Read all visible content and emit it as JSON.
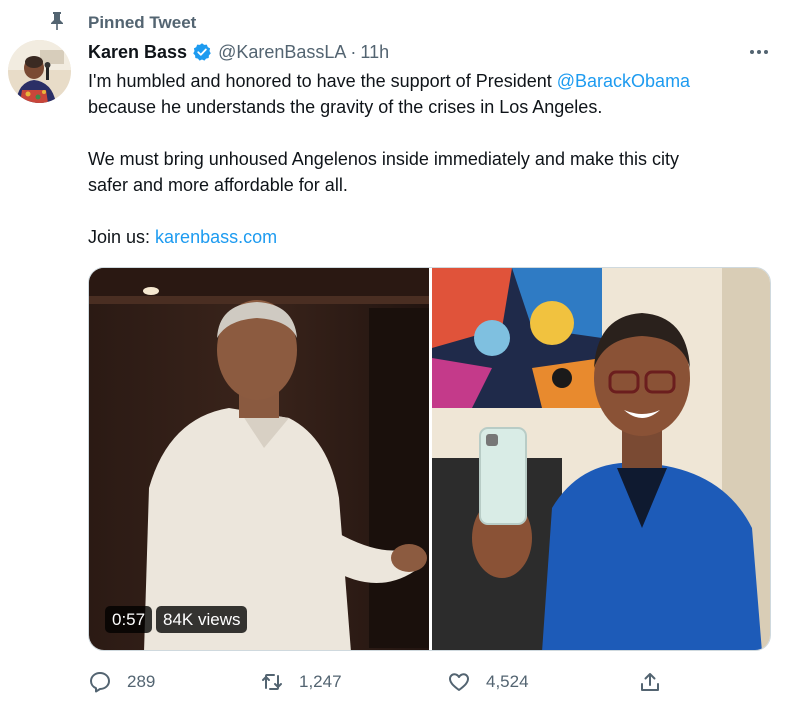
{
  "pinned": {
    "label": "Pinned Tweet",
    "icon": "pin-icon"
  },
  "author": {
    "display_name": "Karen Bass",
    "handle": "@KarenBassLA",
    "separator": "·",
    "timestamp": "11h",
    "verified": true
  },
  "tweet": {
    "line1_pre": "I'm humbled and honored to have the support of President ",
    "mention": "@BarackObama",
    "line2": "because he understands the gravity of the crises in Los Angeles.",
    "line3": "We must bring unhoused Angelenos inside immediately and make this city",
    "line4": "safer and more affordable for all.",
    "join_label": "Join us: ",
    "join_link": "karenbass.com"
  },
  "media": {
    "duration": "0:57",
    "views": "84K views"
  },
  "actions": {
    "replies": "289",
    "retweets": "1,247",
    "likes": "4,524"
  },
  "colors": {
    "link": "#1d9bf0",
    "muted": "#536471",
    "text": "#0f1419",
    "verified": "#1d9bf0"
  }
}
